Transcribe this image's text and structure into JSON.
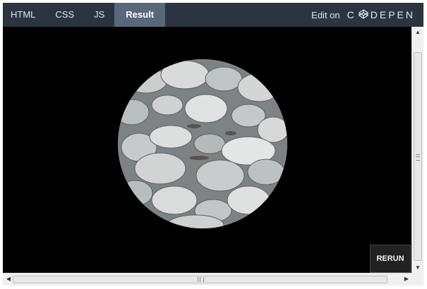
{
  "tabs": {
    "html": "HTML",
    "css": "CSS",
    "js": "JS",
    "result": "Result"
  },
  "edit_on": {
    "label": "Edit on",
    "brand_prefix": "C",
    "brand_suffix": "DEPEN"
  },
  "result": {
    "image_name": "rocks-image",
    "rerun_label": "RERUN"
  },
  "colors": {
    "topbar_bg": "#2b3440",
    "active_tab_bg": "#58687b",
    "result_bg": "#000000"
  },
  "icons": {
    "logo": "codepen-logo-icon",
    "scroll_up": "scroll-up-arrow-icon",
    "scroll_down": "scroll-down-arrow-icon",
    "scroll_left": "scroll-left-arrow-icon",
    "scroll_right": "scroll-right-arrow-icon"
  }
}
